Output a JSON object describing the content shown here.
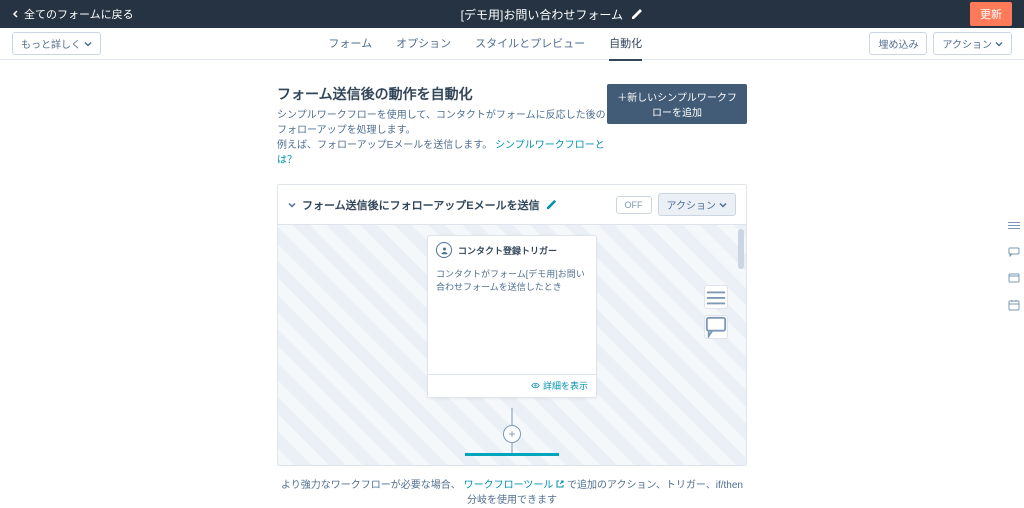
{
  "topbar": {
    "back": "全てのフォームに戻る",
    "title": "[デモ用]お問い合わせフォーム",
    "update": "更新"
  },
  "subbar": {
    "more": "もっと詳しく",
    "tabs": [
      "フォーム",
      "オプション",
      "スタイルとプレビュー",
      "自動化"
    ],
    "embed": "埋め込み",
    "actions": "アクション"
  },
  "main": {
    "heading": "フォーム送信後の動作を自動化",
    "desc1": "シンプルワークフローを使用して、コンタクトがフォームに反応した後のフォローアップを処理します。",
    "desc2": "例えば、フォローアップEメールを送信します。",
    "wf_link": "シンプルワークフローとは？",
    "add_wf": "＋新しいシンプルワークフローを追加"
  },
  "card": {
    "title": "フォーム送信後にフォローアップEメールを送信",
    "off": "OFF",
    "actions": "アクション"
  },
  "trigger": {
    "title": "コンタクト登録トリガー",
    "body": "コンタクトがフォーム[デモ用]お問い合わせフォームを送信したとき",
    "details": "詳細を表示"
  },
  "footer": {
    "text1": "より強力なワークフローが必要な場合、",
    "link": "ワークフローツール",
    "text2": "で追加のアクション、トリガー、if/then分岐を使用できます"
  }
}
